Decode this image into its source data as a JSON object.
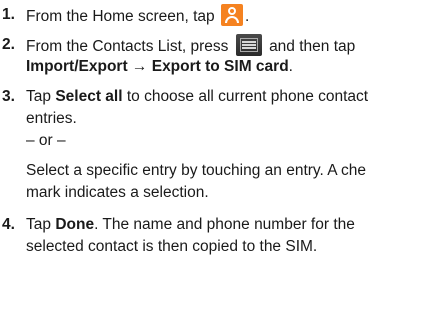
{
  "steps": [
    {
      "number": "1.",
      "line1_before": "From the Home screen, tap",
      "line1_after": "."
    },
    {
      "number": "2.",
      "line1_before": "From the Contacts List, press",
      "line1_after": "and then tap",
      "line2_bold": "Import/Export → Export to SIM card",
      "line2_after": "."
    },
    {
      "number": "3.",
      "line1_before": "Tap ",
      "line1_bold": "Select all",
      "line1_after": " to choose all current phone contact",
      "line2": "entries.",
      "separator": "– or –",
      "alt_line1": "Select a specific entry by touching an entry. A che",
      "alt_line2": "mark indicates a selection."
    },
    {
      "number": "4.",
      "line1_before": "Tap ",
      "line1_bold": "Done",
      "line1_after": ". The name and phone number for the",
      "line2": "selected contact is then copied to the SIM."
    }
  ],
  "icons": {
    "contacts": "contacts-icon",
    "menu": "menu-icon",
    "contacts_color": "#f58220",
    "menu_color": "#333333"
  }
}
